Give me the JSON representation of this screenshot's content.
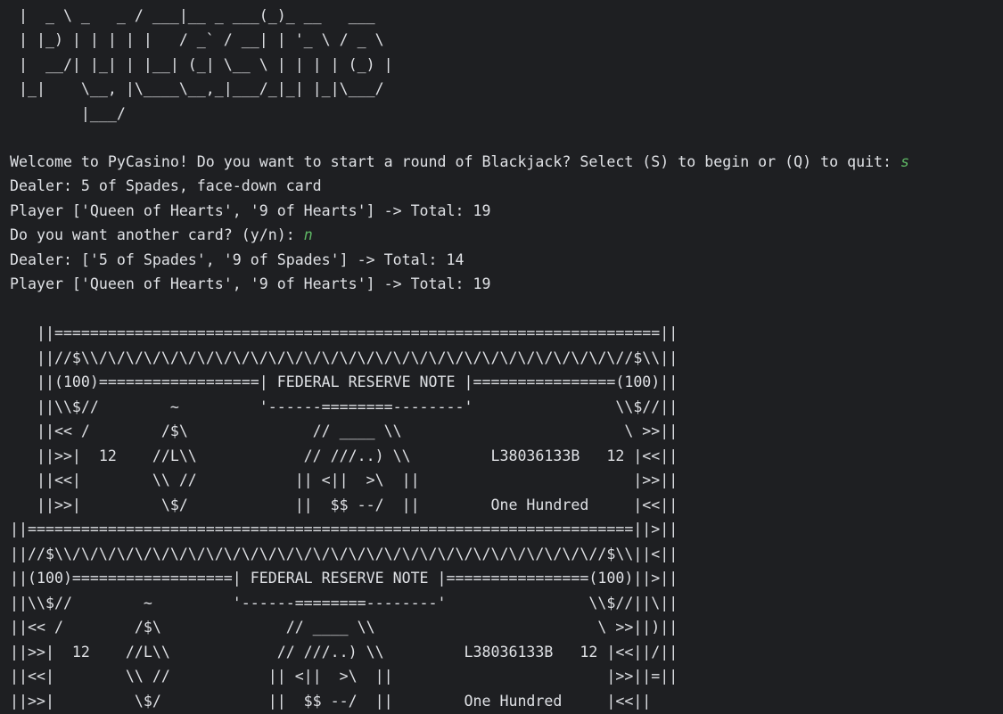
{
  "console": {
    "banner_lines": [
      " |  _ \\ _   _ / ___|__ _ ___(_)_ __   ___",
      " | |_) | | | | |   / _` / __| | '_ \\ / _ \\",
      " |  __/| |_| | |__| (_| \\__ \\ | | | | (_) |",
      " |_|    \\__, |\\____\\__,_|___/_|_| |_|\\___/",
      "        |___/"
    ],
    "session": [
      {
        "text": "Welcome to PyCasino! Do you want to start a round of Blackjack? Select (S) to begin or (Q) to quit: ",
        "input": "s"
      },
      {
        "text": "Dealer: 5 of Spades, face-down card",
        "input": ""
      },
      {
        "text": "Player ['Queen of Hearts', '9 of Hearts'] -> Total: 19",
        "input": ""
      },
      {
        "text": "Do you want another card? (y/n): ",
        "input": "n"
      },
      {
        "text": "Dealer: ['5 of Spades', '9 of Spades'] -> Total: 14",
        "input": ""
      },
      {
        "text": "Player ['Queen of Hearts', '9 of Hearts'] -> Total: 19",
        "input": ""
      }
    ],
    "bill_lines": [
      "   ||====================================================================||",
      "   ||//$\\\\/\\/\\/\\/\\/\\/\\/\\/\\/\\/\\/\\/\\/\\/\\/\\/\\/\\/\\/\\/\\/\\/\\/\\/\\/\\/\\/\\/\\/\\//$\\\\||",
      "   ||(100)==================| FEDERAL RESERVE NOTE |================(100)||",
      "   ||\\\\$//        ~         '------========--------'                \\\\$//||",
      "   ||<< /        /$\\              // ____ \\\\                         \\ >>||",
      "   ||>>|  12    //L\\\\            // ///..) \\\\         L38036133B   12 |<<||",
      "   ||<<|        \\\\ //           || <||  >\\  ||                        |>>||",
      "   ||>>|         \\$/            ||  $$ --/  ||        One Hundred     |<<||",
      "||====================================================================||>||",
      "||//$\\\\/\\/\\/\\/\\/\\/\\/\\/\\/\\/\\/\\/\\/\\/\\/\\/\\/\\/\\/\\/\\/\\/\\/\\/\\/\\/\\/\\/\\/\\//$\\\\||<||",
      "||(100)==================| FEDERAL RESERVE NOTE |================(100)||>||",
      "||\\\\$//        ~         '------========--------'                \\\\$//||\\||",
      "||<< /        /$\\              // ____ \\\\                         \\ >>||)||",
      "||>>|  12    //L\\\\            // ///..) \\\\         L38036133B   12 |<<||/||",
      "||<<|        \\\\ //           || <||  >\\  ||                        |>>||=||",
      "||>>|         \\$/            ||  $$ --/  ||        One Hundred     |<<||"
    ]
  }
}
